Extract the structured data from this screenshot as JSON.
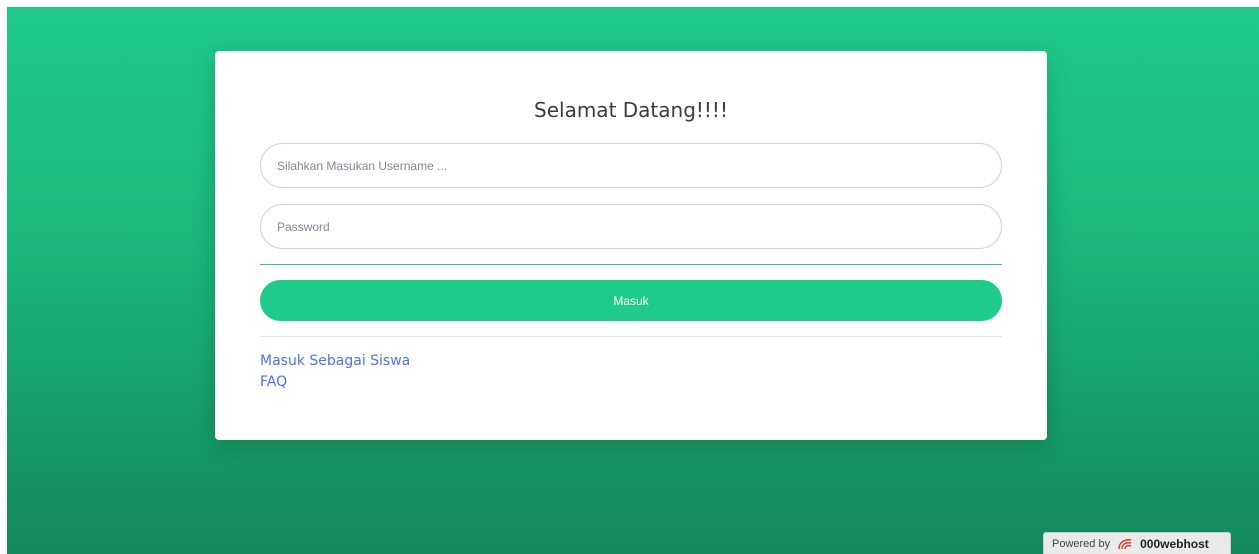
{
  "login": {
    "title": "Selamat Datang!!!!",
    "username_placeholder": "Silahkan Masukan Username ...",
    "password_placeholder": "Password",
    "submit_label": "Masuk"
  },
  "links": {
    "student_login": "Masuk Sebagai Siswa",
    "faq": "FAQ"
  },
  "footer": {
    "powered_by": "Powered by",
    "brand": "000webhost",
    "icon": "000webhost-logo-icon"
  },
  "colors": {
    "primary": "#1ecb8a",
    "link": "#4e73df",
    "brand_icon": "#e0423c"
  }
}
